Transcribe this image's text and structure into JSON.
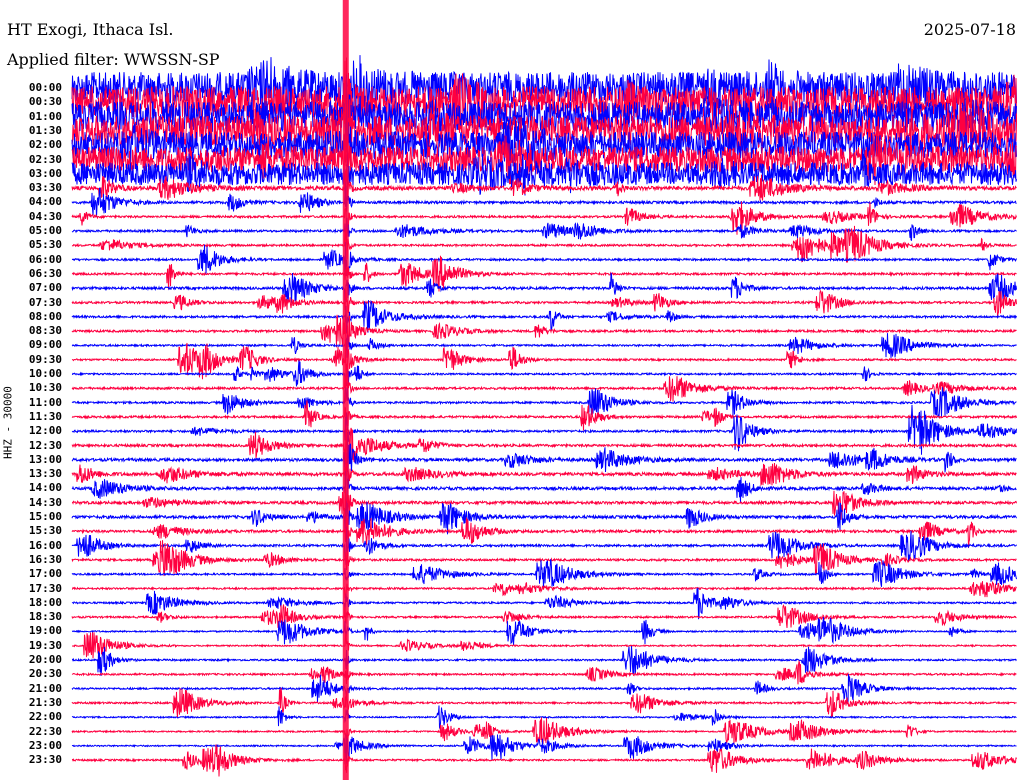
{
  "chart_data": {
    "type": "line",
    "subtype": "helicorder",
    "title": "HT Exogi, Ithaca Isl.",
    "date": "2025-07-18",
    "filter_label": "Applied filter: WWSSN-SP",
    "ylabel": "HHZ - 30000",
    "minutes_per_line": 30,
    "row_labels": [
      "00:00",
      "00:30",
      "01:00",
      "01:30",
      "02:00",
      "02:30",
      "03:00",
      "03:30",
      "04:00",
      "04:30",
      "05:00",
      "05:30",
      "06:00",
      "06:30",
      "07:00",
      "07:30",
      "08:00",
      "08:30",
      "09:00",
      "09:30",
      "10:00",
      "10:30",
      "11:00",
      "11:30",
      "12:00",
      "12:30",
      "13:00",
      "13:30",
      "14:00",
      "14:30",
      "15:00",
      "15:30",
      "16:00",
      "16:30",
      "17:00",
      "17:30",
      "18:00",
      "18:30",
      "19:00",
      "19:30",
      "20:00",
      "20:30",
      "21:00",
      "21:30",
      "22:00",
      "22:30",
      "23:00",
      "23:30"
    ],
    "trace_colors": [
      "#0000ff",
      "#ff0040"
    ],
    "relative_noise_level": [
      1.0,
      1.0,
      0.95,
      0.95,
      0.85,
      0.8,
      0.7,
      0.55,
      0.35,
      0.3,
      0.3,
      0.28,
      0.28,
      0.3,
      0.35,
      0.3,
      0.3,
      0.3,
      0.25,
      0.25,
      0.25,
      0.3,
      0.28,
      0.3,
      0.3,
      0.35,
      0.4,
      0.45,
      0.4,
      0.4,
      0.4,
      0.35,
      0.3,
      0.3,
      0.25,
      0.25,
      0.25,
      0.25,
      0.2,
      0.2,
      0.25,
      0.25,
      0.25,
      0.25,
      0.2,
      0.2,
      0.2,
      0.25
    ],
    "major_event": {
      "start_line": "00:30",
      "minute_offset": 8.7
    }
  }
}
